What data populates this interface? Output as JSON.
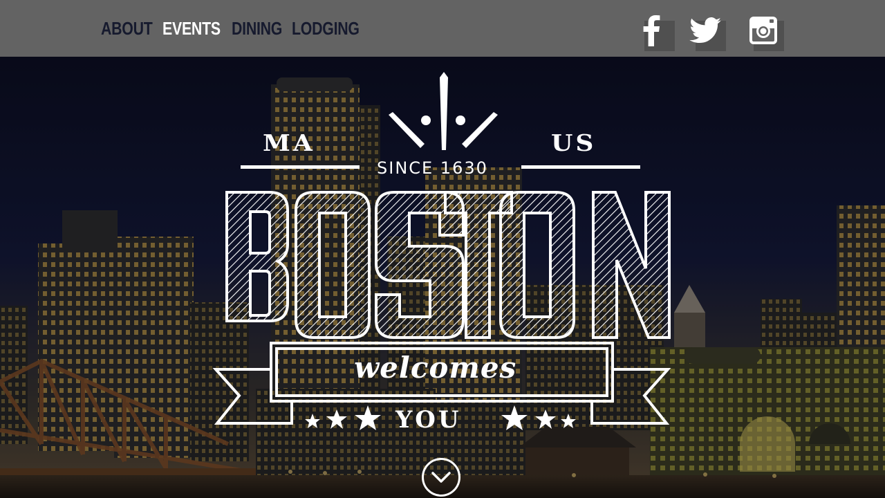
{
  "nav": {
    "items": [
      {
        "label": "ABOUT",
        "active": false
      },
      {
        "label": "EVENTS",
        "active": true
      },
      {
        "label": "DINING",
        "active": false
      },
      {
        "label": "LODGING",
        "active": false
      }
    ],
    "social": [
      "facebook-icon",
      "twitter-icon",
      "instagram-icon"
    ]
  },
  "hero": {
    "left_tag": "MA",
    "right_tag": "US",
    "since": "SINCE 1630",
    "title": "BOSTON",
    "banner": "welcomes",
    "tagline": "YOU",
    "scroll_icon": "chevron-down-icon"
  },
  "colors": {
    "navbar": "#636363",
    "nav_text": "#161a2e",
    "nav_active": "#ffffff",
    "logo": "#ffffff"
  }
}
